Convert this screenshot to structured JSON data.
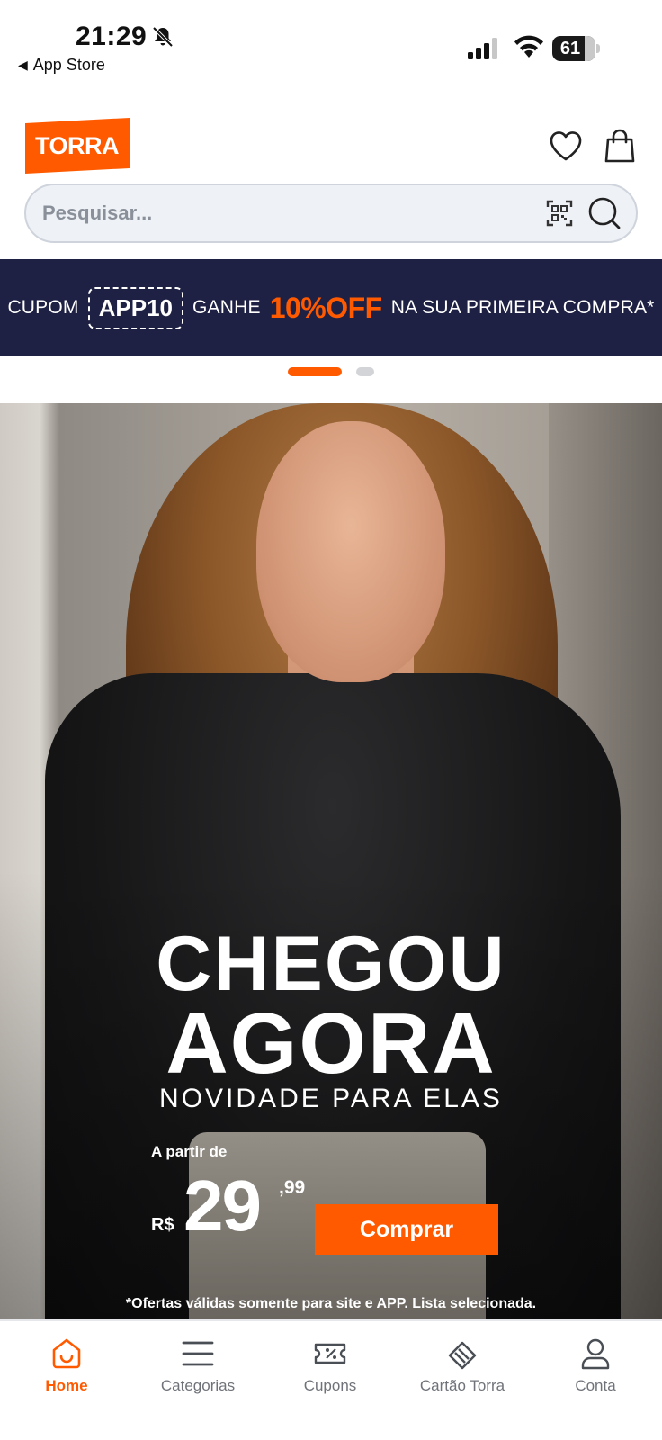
{
  "status_bar": {
    "time": "21:29",
    "back_label": "App Store",
    "battery": "61"
  },
  "header": {
    "logo_text": "TORRA"
  },
  "search": {
    "placeholder": "Pesquisar..."
  },
  "coupon_banner": {
    "prefix": "CUPOM",
    "code": "APP10",
    "middle": "GANHE",
    "offer": "10%OFF",
    "suffix": "NA SUA PRIMEIRA COMPRA*"
  },
  "carousel": {
    "active_index": 1,
    "total": 2
  },
  "hero": {
    "title_line1": "CHEGOU",
    "title_line2": "AGORA",
    "subtitle": "NOVIDADE PARA ELAS",
    "price_from": "A partir de",
    "currency": "R$",
    "price": "29",
    "cents": ",99",
    "cta": "Comprar",
    "disclaimer": "*Ofertas válidas somente para site e APP. Lista selecionada."
  },
  "bottom_nav": [
    {
      "label": "Home",
      "icon": "home-icon",
      "active": true
    },
    {
      "label": "Categorias",
      "icon": "menu-icon",
      "active": false
    },
    {
      "label": "Cupons",
      "icon": "coupon-icon",
      "active": false
    },
    {
      "label": "Cartão Torra",
      "icon": "card-icon",
      "active": false
    },
    {
      "label": "Conta",
      "icon": "user-icon",
      "active": false
    }
  ],
  "colors": {
    "brand": "#ff5a00",
    "banner_bg": "#1e2143",
    "inactive": "#6f7379"
  }
}
